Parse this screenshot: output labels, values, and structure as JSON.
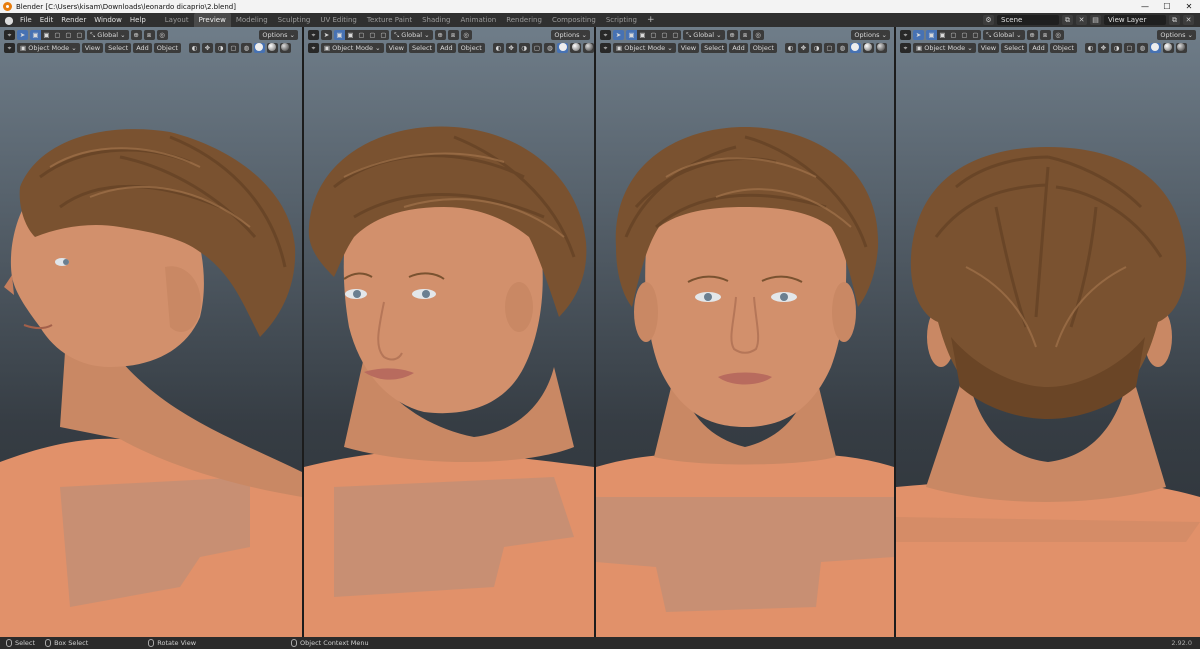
{
  "window": {
    "title": "Blender [C:\\Users\\kisam\\Downloads\\leonardo dicaprio\\2.blend]",
    "controls": [
      "—",
      "☐",
      "✕"
    ]
  },
  "menu": [
    "File",
    "Edit",
    "Render",
    "Window",
    "Help"
  ],
  "workspace_tabs": [
    "Layout",
    "Preview",
    "Modeling",
    "Sculpting",
    "UV Editing",
    "Texture Paint",
    "Shading",
    "Animation",
    "Rendering",
    "Compositing",
    "Scripting"
  ],
  "active_tab": "Preview",
  "scene": {
    "name": "Scene",
    "view_layer": "View Layer"
  },
  "viewport_header": {
    "transform_orientation": "Global",
    "options_label": "Options",
    "mode": "Object Mode",
    "view_menu": "View",
    "select_menu": "Select",
    "add_menu": "Add",
    "object_menu": "Object"
  },
  "viewports": [
    {
      "view": "left-profile"
    },
    {
      "view": "three-quarter"
    },
    {
      "view": "front"
    },
    {
      "view": "back"
    }
  ],
  "statusbar": {
    "select": "Select",
    "box_select": "Box Select",
    "rotate_view": "Rotate View",
    "context_menu": "Object Context Menu",
    "version": "2.92.0"
  },
  "colors": {
    "hair": "#7a5230",
    "skin": "#d2906c",
    "body": "#e1916a",
    "chest_patch": "#b48e7a",
    "accent": "#4772b3"
  }
}
